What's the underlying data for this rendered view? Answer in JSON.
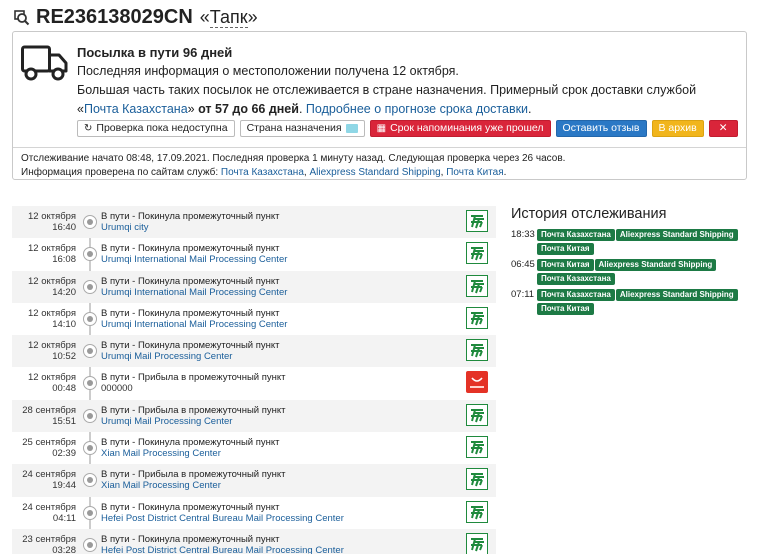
{
  "header": {
    "tracking_number": "RE236138029CN",
    "label_open": "«",
    "label_name": "Тапк",
    "label_close": "»"
  },
  "status": {
    "title": "Посылка в пути 96 дней",
    "last_info": "Последняя информация о местоположении получена 12 октября.",
    "desc_part1": "Большая часть таких посылок не отслеживается в стране назначения. Примерный срок доставки службой «",
    "desc_service_link": "Почта Казахстана",
    "desc_part2": "» ",
    "desc_range": "от 57 до 66 дней",
    "desc_part3": ". ",
    "desc_more_link": "Подробнее о прогнозе срока доставки",
    "desc_end": ".",
    "buttons": {
      "check": "Проверка пока недоступна",
      "country": "Страна назначения",
      "reminder": "Срок напоминания уже прошел",
      "review": "Оставить отзыв",
      "archive": "В архив",
      "close": "✕"
    },
    "meta_line1": "Отслеживание начато 08:48, 17.09.2021. Последняя проверка 1 минуту назад. Следующая проверка через 26 часов.",
    "meta_line2_prefix": "Информация проверена по сайтам служб: ",
    "services": [
      "Почта Казахстана",
      "Aliexpress Standard Shipping",
      "Почта Китая"
    ],
    "sep1": ", ",
    "sep_end": "."
  },
  "events": [
    {
      "date": "12 октября",
      "time": "16:40",
      "status": "В пути - Покинула промежуточный пункт",
      "location": "Urumqi city",
      "carrier": "china-post-icon"
    },
    {
      "date": "12 октября",
      "time": "16:08",
      "status": "В пути - Покинула промежуточный пункт",
      "location": "Urumqi International Mail Processing Center",
      "carrier": "china-post-icon"
    },
    {
      "date": "12 октября",
      "time": "14:20",
      "status": "В пути - Покинула промежуточный пункт",
      "location": "Urumqi International Mail Processing Center",
      "carrier": "china-post-icon"
    },
    {
      "date": "12 октября",
      "time": "14:10",
      "status": "В пути - Покинула промежуточный пункт",
      "location": "Urumqi International Mail Processing Center",
      "carrier": "china-post-icon"
    },
    {
      "date": "12 октября",
      "time": "10:52",
      "status": "В пути - Покинула промежуточный пункт",
      "location": "Urumqi Mail Processing Center",
      "carrier": "china-post-icon"
    },
    {
      "date": "12 октября",
      "time": "00:48",
      "status": "В пути - Прибыла в промежуточный пункт",
      "location": "000000",
      "carrier": "aliexpress-icon"
    },
    {
      "date": "28 сентября",
      "time": "15:51",
      "status": "В пути - Прибыла в промежуточный пункт",
      "location": "Urumqi Mail Processing Center",
      "carrier": "china-post-icon"
    },
    {
      "date": "25 сентября",
      "time": "02:39",
      "status": "В пути - Покинула промежуточный пункт",
      "location": "Xian Mail Processing Center",
      "carrier": "china-post-icon"
    },
    {
      "date": "24 сентября",
      "time": "19:44",
      "status": "В пути - Прибыла в промежуточный пункт",
      "location": "Xian Mail Processing Center",
      "carrier": "china-post-icon"
    },
    {
      "date": "24 сентября",
      "time": "04:11",
      "status": "В пути - Покинула промежуточный пункт",
      "location": "Hefei Post District Central Bureau Mail Processing Center",
      "carrier": "china-post-icon"
    },
    {
      "date": "23 сентября",
      "time": "03:28",
      "status": "В пути - Покинула промежуточный пункт",
      "location": "Hefei Post District Central Bureau Mail Processing Center",
      "carrier": "china-post-icon"
    }
  ],
  "history": {
    "title": "История отслеживания",
    "rows": [
      {
        "time": "18:33",
        "tags": [
          "Почта Казахстана",
          "Aliexpress Standard Shipping"
        ],
        "tags2": [
          "Почта Китая"
        ]
      },
      {
        "time": "06:45",
        "tags": [
          "Почта Китая",
          "Aliexpress Standard Shipping"
        ],
        "tags2": [
          "Почта Казахстана"
        ]
      },
      {
        "time": "07:11",
        "tags": [
          "Почта Казахстана",
          "Aliexpress Standard Shipping"
        ],
        "tags2": [
          "Почта Китая"
        ]
      }
    ]
  },
  "colors": {
    "link": "#1a5e9a",
    "red": "#d9253a",
    "blue": "#2a78c5",
    "yellow": "#f1b51c",
    "tag_green": "#1d7a45",
    "china_post_green": "#1f8a3d",
    "aliexpress_red": "#e43226"
  }
}
